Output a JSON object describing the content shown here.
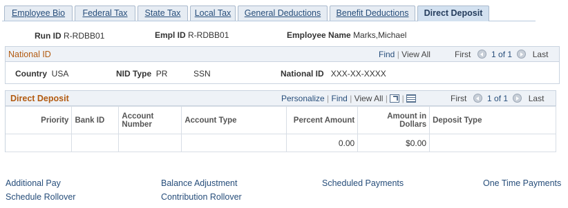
{
  "tabs": [
    {
      "label": "Employee Bio",
      "active": false
    },
    {
      "label": "Federal Tax",
      "active": false
    },
    {
      "label": "State Tax",
      "active": false
    },
    {
      "label": "Local Tax",
      "active": false
    },
    {
      "label": "General Deductions",
      "active": false
    },
    {
      "label": "Benefit Deductions",
      "active": false
    },
    {
      "label": "Direct Deposit",
      "active": true
    }
  ],
  "header": {
    "run_id_label": "Run ID",
    "run_id": "R-RDBB01",
    "empl_id_label": "Empl ID",
    "empl_id": "R-RDBB01",
    "employee_name_label": "Employee Name",
    "employee_name": "Marks,Michael"
  },
  "national_id": {
    "title": "National ID",
    "find": "Find",
    "view_all": "View All",
    "first": "First",
    "range": "1 of 1",
    "last": "Last",
    "country_label": "Country",
    "country": "USA",
    "nid_type_label": "NID Type",
    "nid_type": "PR",
    "nid_type_desc": "SSN",
    "national_id_label": "National ID",
    "national_id": "XXX-XX-XXXX"
  },
  "direct_deposit": {
    "title": "Direct Deposit",
    "personalize": "Personalize",
    "find": "Find",
    "view_all": "View All",
    "first": "First",
    "range": "1 of 1",
    "last": "Last",
    "columns": {
      "priority": "Priority",
      "bank_id": "Bank ID",
      "account_number": "Account Number",
      "account_type": "Account Type",
      "percent_amount": "Percent Amount",
      "amount_in_dollars": "Amount in Dollars",
      "deposit_type": "Deposit Type"
    },
    "rows": [
      {
        "priority": "",
        "bank_id": "",
        "account_number": "",
        "account_type": "",
        "percent_amount": "0.00",
        "amount_in_dollars": "$0.00",
        "deposit_type": ""
      }
    ]
  },
  "links": {
    "additional_pay": "Additional Pay",
    "balance_adjustment": "Balance Adjustment",
    "scheduled_payments": "Scheduled Payments",
    "one_time_payments": "One Time Payments",
    "schedule_rollover": "Schedule Rollover",
    "contribution_rollover": "Contribution Rollover"
  }
}
